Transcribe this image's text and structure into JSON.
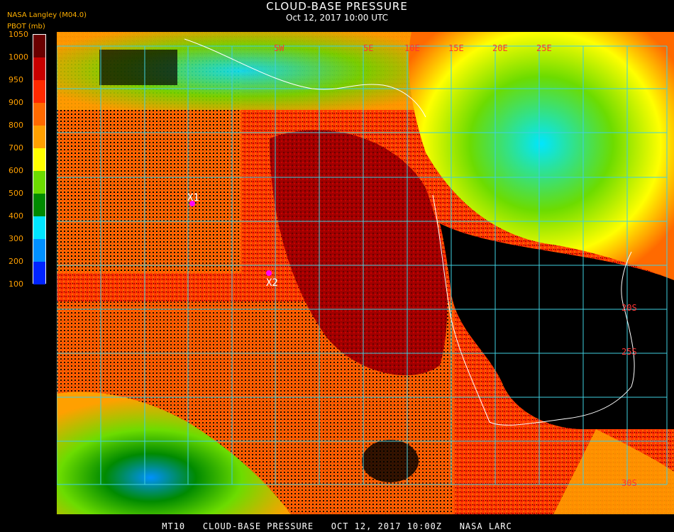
{
  "header": {
    "title": "CLOUD-BASE PRESSURE",
    "subtitle": "Oct 12, 2017 10:00 UTC",
    "org": "NASA Langley (M04.0)",
    "unit": "PBOT (mb)"
  },
  "legend": {
    "labels": [
      "1050",
      "1000",
      "950",
      "900",
      "800",
      "700",
      "600",
      "500",
      "400",
      "300",
      "200",
      "100"
    ],
    "colors": [
      "#6a0000",
      "#c80000",
      "#ff2a00",
      "#ff6a00",
      "#ffa000",
      "#ffff00",
      "#6cdc00",
      "#008a00",
      "#00e6ff",
      "#0090ff",
      "#0024ff",
      "#8a2be2"
    ]
  },
  "map": {
    "markers": [
      {
        "label": "X1",
        "color": "#ff00ff"
      },
      {
        "label": "X2",
        "color": "#ff00ff"
      }
    ],
    "lon_labels": [
      "5W",
      "5E",
      "10E",
      "15E",
      "20E",
      "25E"
    ],
    "lat_labels": [
      "20S",
      "25S",
      "30S"
    ],
    "grid_color": "#40d0e0"
  },
  "footer": {
    "text": "MT10   CLOUD-BASE PRESSURE   OCT 12, 2017 10:00Z   NASA LARC"
  }
}
